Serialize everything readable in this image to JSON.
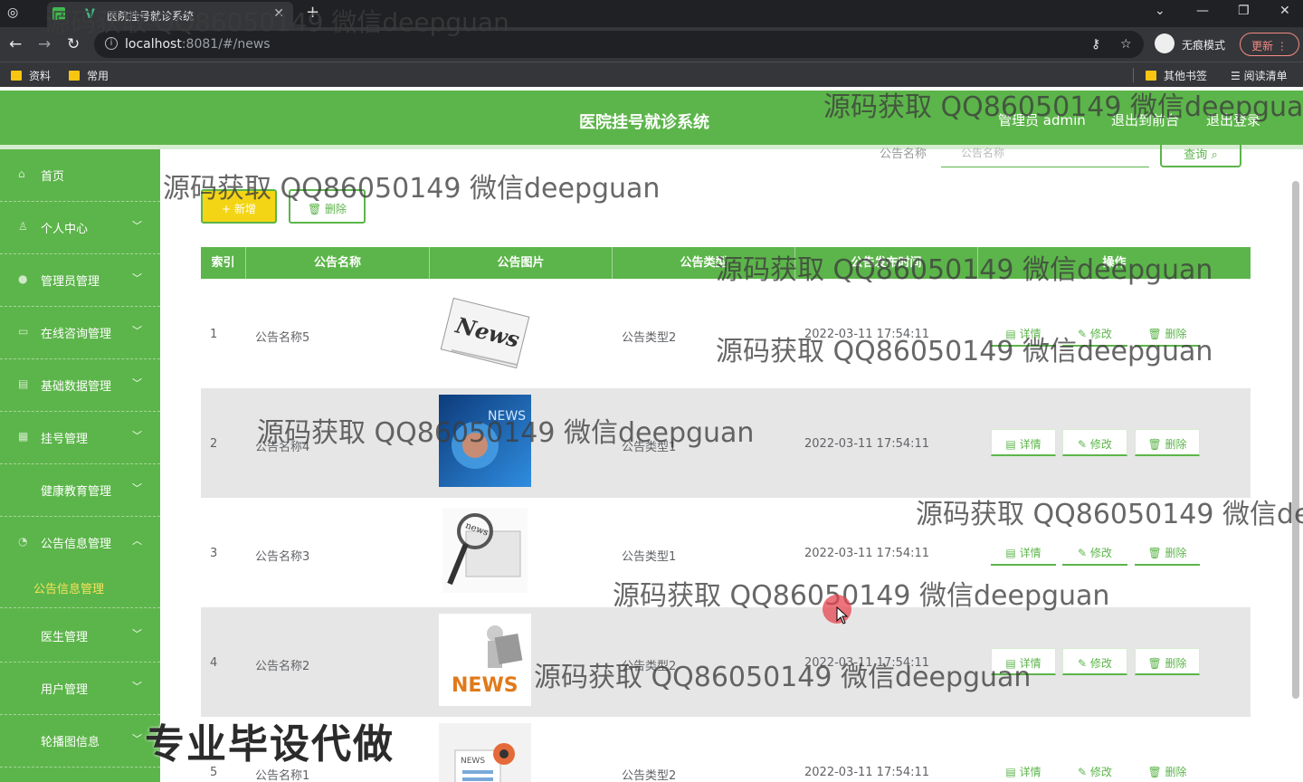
{
  "browser": {
    "tab_title": "医院挂号就诊系统",
    "url_host": "localhost",
    "url_rest": ":8081/#/news",
    "profile_label": "无痕模式",
    "update_label": "更新",
    "bookmarks": [
      "资料",
      "常用",
      "其他书签",
      "阅读清单"
    ]
  },
  "header": {
    "title": "医院挂号就诊系统",
    "admin_label": "管理员 admin",
    "back_label": "退出到前台",
    "logout_label": "退出登录"
  },
  "sidebar": {
    "items": [
      {
        "label": "首页",
        "icon": "home-icon"
      },
      {
        "label": "个人中心",
        "icon": "user-icon"
      },
      {
        "label": "管理员管理",
        "icon": "admin-icon"
      },
      {
        "label": "在线咨询管理",
        "icon": "chat-icon"
      },
      {
        "label": "基础数据管理",
        "icon": "data-icon"
      },
      {
        "label": "挂号管理",
        "icon": "register-icon"
      },
      {
        "label": "健康教育管理",
        "icon": "education-icon"
      },
      {
        "label": "公告信息管理",
        "icon": "notice-icon"
      },
      {
        "label": "医生管理",
        "icon": "doctor-icon"
      },
      {
        "label": "用户管理",
        "icon": "users-icon"
      },
      {
        "label": "轮播图信息",
        "icon": "carousel-icon"
      }
    ],
    "submenu_label": "公告信息管理"
  },
  "toolbar": {
    "search_label": "公告名称",
    "search_placeholder": "公告名称",
    "search_button": "查询",
    "add_button": "新增",
    "delete_button": "删除"
  },
  "table": {
    "headers": [
      "索引",
      "公告名称",
      "公告图片",
      "公告类型",
      "公告发布时间",
      "操作"
    ],
    "rows": [
      {
        "index": "1",
        "name": "公告名称5",
        "type": "公告类型2",
        "time": "2022-03-11 17:54:11"
      },
      {
        "index": "2",
        "name": "公告名称4",
        "type": "公告类型1",
        "time": "2022-03-11 17:54:11"
      },
      {
        "index": "3",
        "name": "公告名称3",
        "type": "公告类型1",
        "time": "2022-03-11 17:54:11"
      },
      {
        "index": "4",
        "name": "公告名称2",
        "type": "公告类型2",
        "time": "2022-03-11 17:54:11"
      },
      {
        "index": "5",
        "name": "公告名称1",
        "type": "公告类型2",
        "time": "2022-03-11 17:54:11"
      }
    ],
    "op_detail": "详情",
    "op_edit": "修改",
    "op_delete": "删除"
  },
  "overlay": {
    "watermark": "源码获取 QQ86050149 微信deepguan",
    "watermark_cut": "源码获取 QQ86050149 微信de",
    "promo": "专业毕设代做"
  },
  "colors": {
    "primary": "#5cb54a",
    "accent_yellow": "#f3d515",
    "sub_active": "#f7e35a"
  }
}
